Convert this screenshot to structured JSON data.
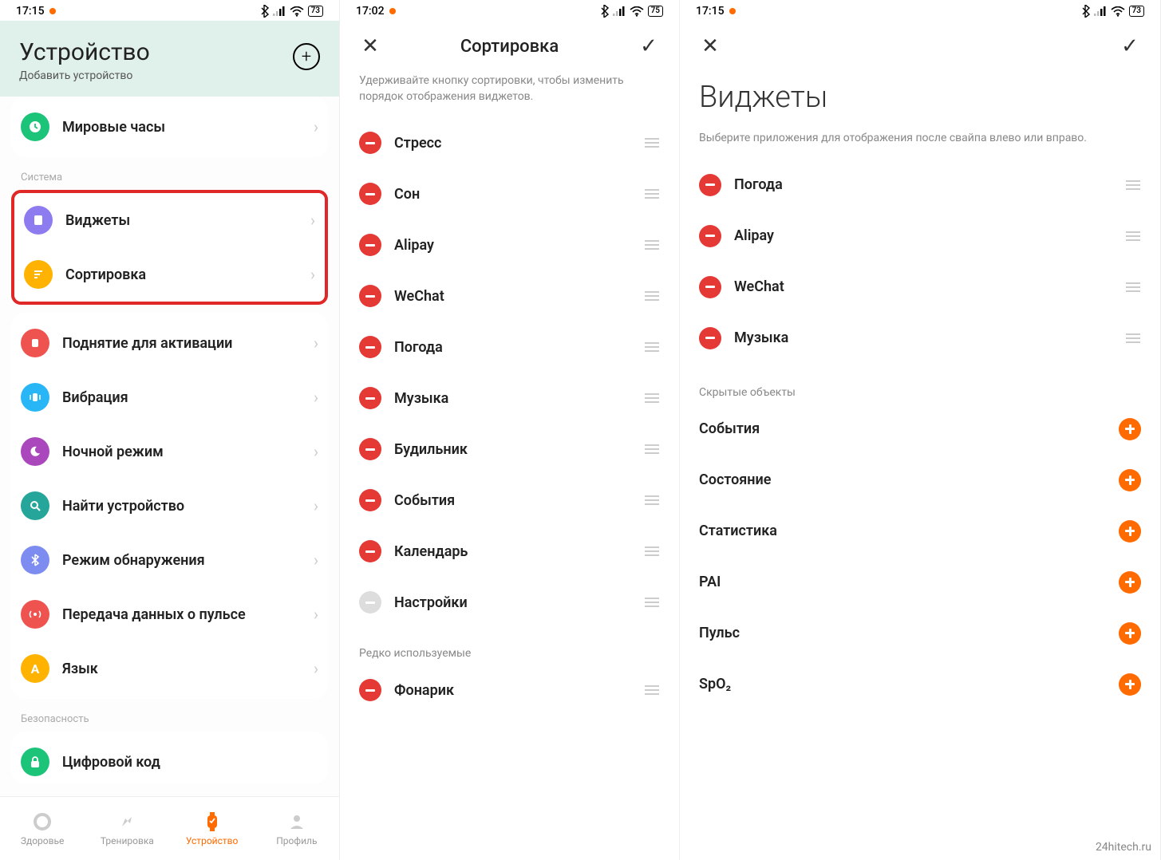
{
  "watermark": "24hitech.ru",
  "screen1": {
    "status": {
      "time": "17:15",
      "battery": "73"
    },
    "header": {
      "title": "Устройство",
      "subtitle": "Добавить устройство"
    },
    "world_clock": "Мировые часы",
    "section_system": "Система",
    "row_widgets": "Виджеты",
    "row_sort": "Сортировка",
    "row_raise": "Поднятие для активации",
    "row_vibration": "Вибрация",
    "row_night": "Ночной режим",
    "row_find": "Найти устройство",
    "row_discover": "Режим обнаружения",
    "row_hr": "Передача данных о пульсе",
    "row_lang": "Язык",
    "section_security": "Безопасность",
    "row_pin": "Цифровой код",
    "nav": {
      "health": "Здоровье",
      "training": "Тренировка",
      "device": "Устройство",
      "profile": "Профиль"
    }
  },
  "screen2": {
    "status": {
      "time": "17:02",
      "battery": "75"
    },
    "title": "Сортировка",
    "hint": "Удерживайте кнопку сортировки, чтобы изменить порядок отображения виджетов.",
    "items": [
      "Стресс",
      "Сон",
      "Alipay",
      "WeChat",
      "Погода",
      "Музыка",
      "Будильник",
      "События",
      "Календарь",
      "Настройки"
    ],
    "rare_label": "Редко используемые",
    "rare_items": [
      "Фонарик"
    ]
  },
  "screen3": {
    "status": {
      "time": "17:15",
      "battery": "73"
    },
    "big_title": "Виджеты",
    "hint": "Выберите приложения для отображения после свайпа влево или вправо.",
    "active_items": [
      "Погода",
      "Alipay",
      "WeChat",
      "Музыка"
    ],
    "hidden_label": "Скрытые объекты",
    "hidden_items": [
      "События",
      "Состояние",
      "Статистика",
      "PAI",
      "Пульс",
      "SpO₂"
    ]
  }
}
